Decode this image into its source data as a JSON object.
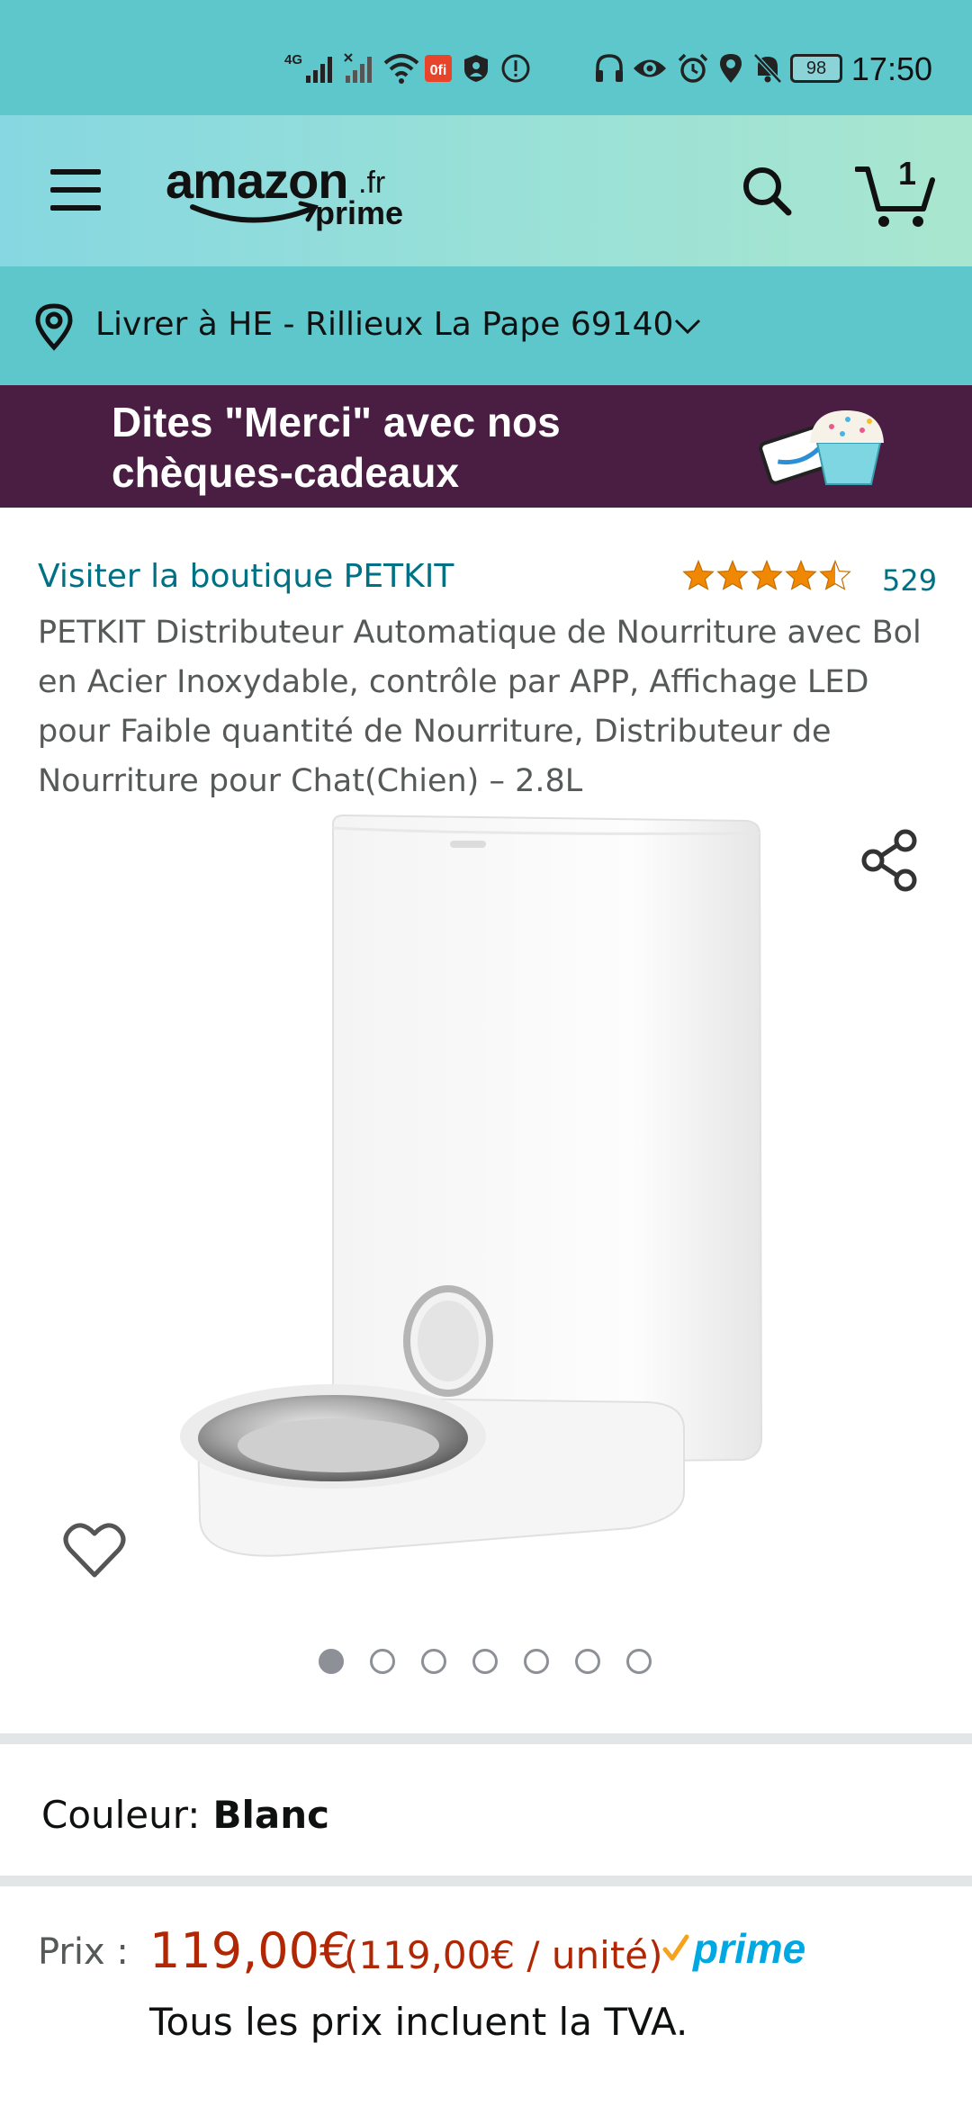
{
  "status_bar": {
    "time": "17:50",
    "network": "4G",
    "battery": "98"
  },
  "header": {
    "logo_word": "amazon",
    "logo_tld": ".fr",
    "logo_prime": "prime",
    "cart_count": "1"
  },
  "delivery": {
    "text": "Livrer à HE - Rillieux La Pape 69140"
  },
  "promo": {
    "line1": "Dites \"Merci\" avec nos",
    "line2": "chèques-cadeaux"
  },
  "product": {
    "brand_link": "Visiter la boutique PETKIT",
    "rating_stars": 4.5,
    "rating_count": "529",
    "title": "PETKIT Distributeur Automatique de Nourriture avec Bol en Acier Inoxydable, contrôle par APP, Affichage LED pour Faible quantité de Nourriture, Distributeur de Nourriture pour Chat(Chien) – 2.8L",
    "image_count": 7,
    "active_image": 1
  },
  "color": {
    "label": "Couleur:",
    "value": "Blanc"
  },
  "price": {
    "label": "Prix :",
    "main": "119,00€",
    "per_unit": "(119,00€ / unité)",
    "prime": "prime",
    "tax_note": "Tous les prix incluent la TVA."
  },
  "colors": {
    "teal": "#5ec7cc",
    "link": "#007185",
    "price": "#b12704",
    "promo_bg": "#4a1e43",
    "star": "#f08804"
  }
}
